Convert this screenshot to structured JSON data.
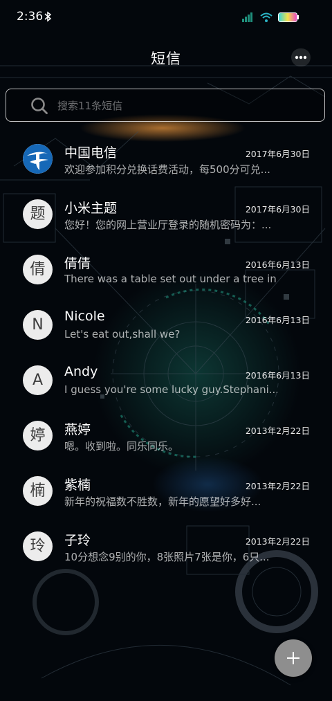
{
  "status_bar": {
    "time": "2:36",
    "icons": [
      "bluetooth-icon",
      "signal-icon",
      "wifi-icon",
      "battery-icon"
    ]
  },
  "header": {
    "title": "短信",
    "more_icon": "more-dots-icon"
  },
  "search": {
    "placeholder": "搜索11条短信",
    "icon": "search-icon"
  },
  "conversations": [
    {
      "avatar": "",
      "avatar_icon": "china-telecom-logo",
      "name": "中国电信",
      "date": "2017年6月30日",
      "preview": "欢迎参加积分兑换话费活动，每500分可兑..."
    },
    {
      "avatar": "题",
      "name": "小米主题",
      "date": "2017年6月30日",
      "preview": "您好！您的网上营业厅登录的随机密码为：..."
    },
    {
      "avatar": "倩",
      "name": "倩倩",
      "date": "2016年6月13日",
      "preview": "There was a table set out under a tree in..."
    },
    {
      "avatar": "N",
      "name": "Nicole",
      "date": "2016年6月13日",
      "preview": "Let's eat out,shall we?"
    },
    {
      "avatar": "A",
      "name": "Andy",
      "date": "2016年6月13日",
      "preview": "I guess you're some lucky guy.Stephani..."
    },
    {
      "avatar": "婷",
      "name": "燕婷",
      "date": "2013年2月22日",
      "preview": "嗯。收到啦。同乐同乐。"
    },
    {
      "avatar": "楠",
      "name": "紫楠",
      "date": "2013年2月22日",
      "preview": "新年的祝福数不胜数，新年的愿望好多好..."
    },
    {
      "avatar": "玲",
      "name": "子玲",
      "date": "2013年2月22日",
      "preview": "10分想念9别的你，8张照片7张是你，6只..."
    }
  ],
  "fab": {
    "icon": "plus-icon"
  },
  "colors": {
    "background": "#03070c",
    "accent_teal": "#1f8f7c",
    "accent_orange": "#d3782a",
    "fab": "#8e8e8e",
    "telecom_blue": "#1668b7"
  }
}
